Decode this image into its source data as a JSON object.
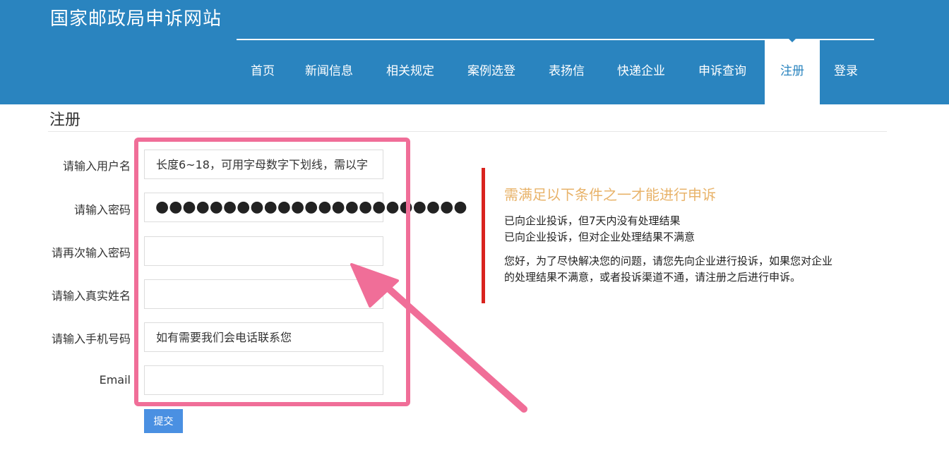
{
  "site": {
    "title": "国家邮政局申诉网站"
  },
  "nav": {
    "items": [
      {
        "label": "首页"
      },
      {
        "label": "新闻信息"
      },
      {
        "label": "相关规定"
      },
      {
        "label": "案例选登"
      },
      {
        "label": "表扬信"
      },
      {
        "label": "快递企业"
      },
      {
        "label": "申诉查询"
      },
      {
        "label": "注册",
        "active": true
      },
      {
        "label": "登录"
      }
    ]
  },
  "page": {
    "title": "注册"
  },
  "form": {
    "username": {
      "label": "请输入用户名",
      "placeholder": "长度6~18，可用字母数字下划线，需以字"
    },
    "password": {
      "label": "请输入密码",
      "value_mask": "●●●●●●●●●●●●●●●●●●●●●●●"
    },
    "password_confirm": {
      "label": "请再次输入密码"
    },
    "real_name": {
      "label": "请输入真实姓名"
    },
    "phone": {
      "label": "请输入手机号码",
      "placeholder": "如有需要我们会电话联系您"
    },
    "email": {
      "label": "Email"
    },
    "submit_label": "提交"
  },
  "info": {
    "title": "需满足以下条件之一才能进行申诉",
    "conditions": [
      "已向企业投诉，但7天内没有处理结果",
      "已向企业投诉，但对企业处理结果不满意"
    ],
    "note_lines": [
      "您好，为了尽快解决您的问题，请您先向企业进行投诉，如果您对企业",
      "的处理结果不满意，或者投诉渠道不通，请注册之后进行申诉。"
    ]
  },
  "colors": {
    "header_bg": "#2a84bf",
    "highlight": "#f06e98",
    "info_bar": "#d9231e",
    "info_title": "#e8b36a",
    "submit_bg": "#4a90e2"
  }
}
